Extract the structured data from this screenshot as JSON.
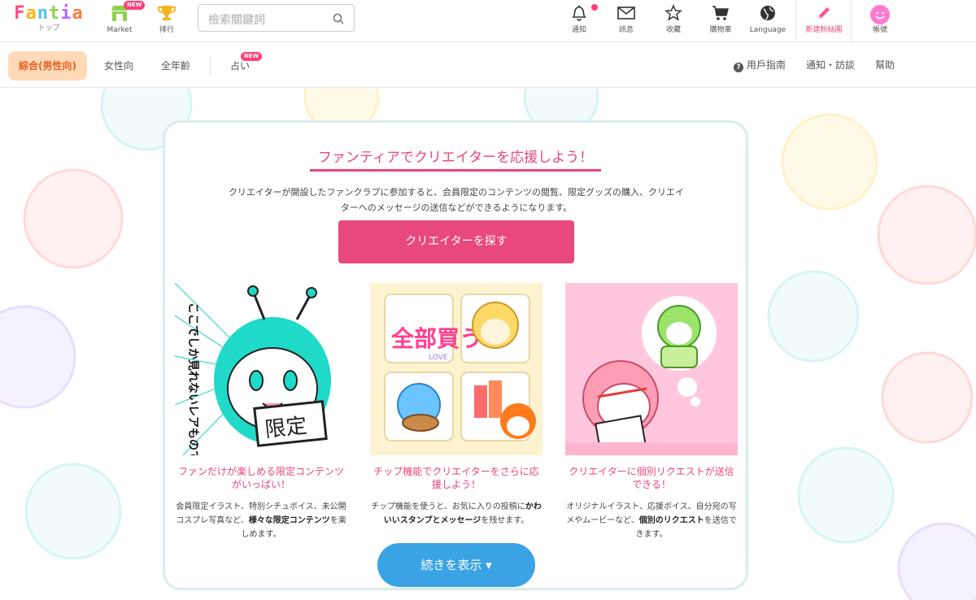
{
  "header": {
    "logo": {
      "text": "Fantia",
      "sub": "トップ"
    },
    "nav_left": [
      {
        "label": "Market",
        "badge": "NEW",
        "icon": "market-icon"
      },
      {
        "label": "排行",
        "icon": "trophy-icon"
      }
    ],
    "search": {
      "placeholder": "檢索關鍵詞"
    },
    "nav_right": [
      {
        "label": "通知",
        "icon": "bell-icon"
      },
      {
        "label": "訊息",
        "icon": "mail-icon"
      },
      {
        "label": "收藏",
        "icon": "star-icon"
      },
      {
        "label": "購物車",
        "icon": "cart-icon"
      },
      {
        "label": "Language",
        "icon": "globe-icon"
      },
      {
        "label": "新建粉絲團",
        "icon": "pencil-icon"
      },
      {
        "label": "帳號",
        "icon": "avatar-icon"
      }
    ]
  },
  "subnav": {
    "tabs": [
      {
        "label": "綜合(男性向)",
        "active": true
      },
      {
        "label": "女性向"
      },
      {
        "label": "全年齡"
      },
      {
        "label": "占い",
        "badge": "NEW"
      }
    ],
    "links": [
      {
        "label": "用戶指南",
        "icon": "help-icon"
      },
      {
        "label": "通知・訪談"
      },
      {
        "label": "幫助"
      }
    ]
  },
  "main": {
    "title": "ファンティアでクリエイターを応援しよう！",
    "desc_line1": "クリエイターが開設したファンクラブに参加すると、会員限定のコンテンツの閲覧、限定グッズの購入、クリエイ",
    "desc_line2": "ターへのメッセージの送信などができるようになります。",
    "cta": "クリエイターを探す",
    "features": [
      {
        "title": "ファンだけが楽しめる限定コンテンツがいっぱい！",
        "desc_a": "会員限定イラスト、特別シチュボイス、未公開コスプレ写真など、",
        "desc_b": "様々な限定コンテンツ",
        "desc_c": "を楽しめます。",
        "art_text_1": "ここでしか見れないレアものですわ！",
        "art_text_2": "限定"
      },
      {
        "title": "チップ機能でクリエイターをさらに応援しよう！",
        "desc_a": "チップ機能を使うと、お気に入りの投稿に",
        "desc_b": "かわいいスタンプとメッセージ",
        "desc_c": "を残せます。",
        "art_text_1": "全部買う",
        "art_text_2": "LOVE"
      },
      {
        "title": "クリエイターに個別リクエストが送信できる！",
        "desc_a": "オリジナルイラスト、応援ボイス、自分宛の写メやムービーなど、",
        "desc_b": "個別のリクエスト",
        "desc_c": "を送信できます。"
      }
    ],
    "more": "続きを表示 ▾"
  },
  "colors": {
    "accent_pink": "#e9487f",
    "accent_blue": "#3aa3e3",
    "active_tab_bg": "#ffd9b8",
    "active_tab_text": "#e8601c"
  }
}
